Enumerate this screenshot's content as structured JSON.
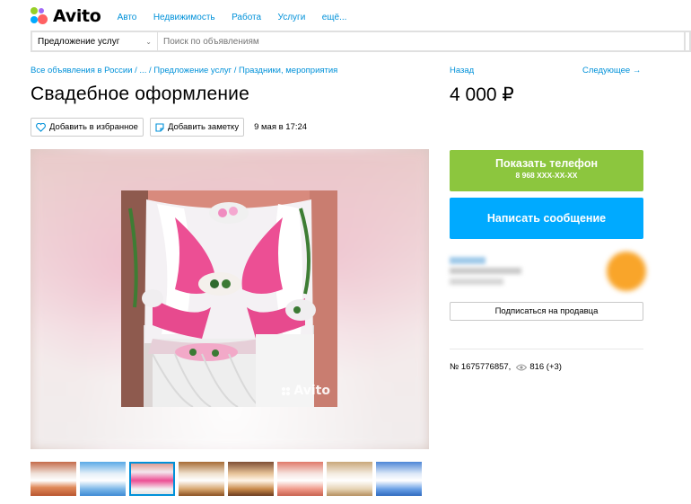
{
  "header": {
    "logo_text": "Avito",
    "nav": [
      "Авто",
      "Недвижимость",
      "Работа",
      "Услуги",
      "ещё..."
    ]
  },
  "search": {
    "category": "Предложение услуг",
    "placeholder": "Поиск по объявлениям"
  },
  "breadcrumb": "Все объявления в России / ... / Предложение услуг / Праздники, мероприятия",
  "nav_links": {
    "back": "Назад",
    "next": "Следующее →"
  },
  "listing": {
    "title": "Свадебное оформление",
    "price": "4 000 ₽",
    "add_favorite": "Добавить в избранное",
    "add_note": "Добавить заметку",
    "date": "9 мая в 17:24",
    "watermark": "Avito",
    "number": "№ 1675776857,",
    "views": "816 (+3)"
  },
  "contact": {
    "show_phone": "Показать телефон",
    "phone_masked": "8 968 XXX-XX-XX",
    "write_message": "Написать сообщение",
    "subscribe": "Подписаться на продавца"
  },
  "colors": {
    "link": "#0091d9",
    "phone_button": "#8cc63e",
    "message_button": "#00aaff"
  },
  "thumbnails_count": 8
}
